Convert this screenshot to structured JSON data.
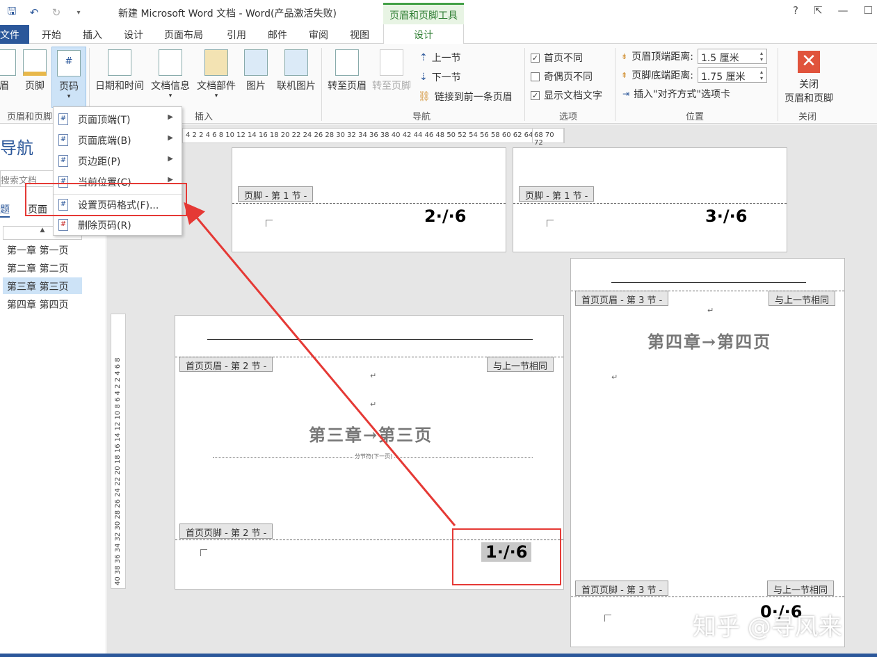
{
  "titlebar": {
    "title": "新建 Microsoft Word 文档 - Word(产品激活失败)",
    "context_tab": "页眉和页脚工具",
    "window_buttons": [
      "?",
      "⇱",
      "—",
      "☐"
    ]
  },
  "tabs": [
    "文件",
    "开始",
    "插入",
    "设计",
    "页面布局",
    "引用",
    "邮件",
    "审阅",
    "视图",
    "设计"
  ],
  "ribbon": {
    "group_header_footer": {
      "header": "眉",
      "footer": "页脚",
      "page_number": "页码",
      "label": "页眉和页脚"
    },
    "group_insert": {
      "datetime": "日期和时间",
      "docinfo": "文档信息",
      "docparts": "文档部件",
      "picture": "图片",
      "online_picture": "联机图片",
      "label": "插入"
    },
    "group_nav": {
      "goto_header": "转至页眉",
      "goto_footer": "转至页脚",
      "prev": "上一节",
      "next": "下一节",
      "link_prev": "链接到前一条页眉",
      "label": "导航"
    },
    "group_options": {
      "diff_first": "首页不同",
      "diff_odd_even": "奇偶页不同",
      "show_text": "显示文档文字",
      "label": "选项"
    },
    "group_position": {
      "header_dist_label": "页眉顶端距离:",
      "header_dist_value": "1.5 厘米",
      "footer_dist_label": "页脚底端距离:",
      "footer_dist_value": "1.75 厘米",
      "insert_align": "插入\"对齐方式\"选项卡",
      "label": "位置"
    },
    "group_close": {
      "close": "关闭",
      "close2": "页眉和页脚",
      "label": "关闭"
    }
  },
  "dropdown": {
    "items": [
      "页面顶端(T)",
      "页面底端(B)",
      "页边距(P)",
      "当前位置(C)",
      "设置页码格式(F)...",
      "删除页码(R)"
    ]
  },
  "navpane": {
    "title": "导航",
    "search_placeholder": "搜索文档",
    "tab_headings": "题",
    "tab_pages": "页面",
    "filter": "▲",
    "items": [
      "第一章 第一页",
      "第二章 第二页",
      "第三章 第三页",
      "第四章 第四页"
    ]
  },
  "ruler": {
    "h_text": "4 2  2 4 6 8 10 12 14 16 18 20 22 24 26 28 30 32 34 36 38 40 42 44 46 48 50 52 54 56 58 60 62 64",
    "h_end": "68 70 72",
    "v_text": "40 38 36 34 32 30 28 26 24 22 20 18 16 14 12 10 8 6 4 2     2 4 6 8"
  },
  "pages": {
    "p1_footer_label": "页脚 - 第 1 节 -",
    "p1_num": "2·/·6",
    "p2_footer_label": "页脚 - 第 1 节 -",
    "p2_num": "3·/·6",
    "p3_header_label": "首页页眉 - 第 2 节 -",
    "p3_same": "与上一节相同",
    "p3_chapter": "第三章→第三页",
    "p3_section_break": "分节符(下一页)",
    "p3_footer_label": "首页页脚 - 第 2 节 -",
    "p3_num": "1·/·6",
    "p4_header_label": "首页页眉 - 第 3 节 -",
    "p4_same": "与上一节相同",
    "p4_chapter": "第四章→第四页",
    "p4_footer_label": "首页页脚 - 第 3 节 -",
    "p4_same2": "与上一节相同",
    "p4_num": "0·/·6"
  },
  "watermark": "知乎 @寻风来",
  "colors": {
    "accent": "#2b579a",
    "context_green": "#2e7d32",
    "annotation_red": "#e53935"
  }
}
